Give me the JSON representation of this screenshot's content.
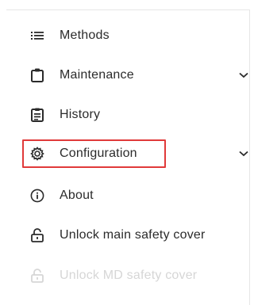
{
  "menu": {
    "items": [
      {
        "label": "Methods",
        "icon": "list-icon",
        "has_chevron": false,
        "disabled": false
      },
      {
        "label": "Maintenance",
        "icon": "clipboard-icon",
        "has_chevron": true,
        "disabled": false
      },
      {
        "label": "History",
        "icon": "document-list-icon",
        "has_chevron": false,
        "disabled": false
      },
      {
        "label": "Configuration",
        "icon": "gear-icon",
        "has_chevron": true,
        "disabled": false,
        "highlighted": true
      },
      {
        "label": "About",
        "icon": "info-icon",
        "has_chevron": false,
        "disabled": false
      },
      {
        "label": "Unlock main safety cover",
        "icon": "unlock-icon",
        "has_chevron": false,
        "disabled": false
      },
      {
        "label": "Unlock MD safety cover",
        "icon": "unlock-icon",
        "has_chevron": false,
        "disabled": true
      }
    ]
  },
  "colors": {
    "text": "#2b2b2b",
    "disabled_text": "#d6d6d6",
    "highlight_border": "#e03a3a"
  }
}
